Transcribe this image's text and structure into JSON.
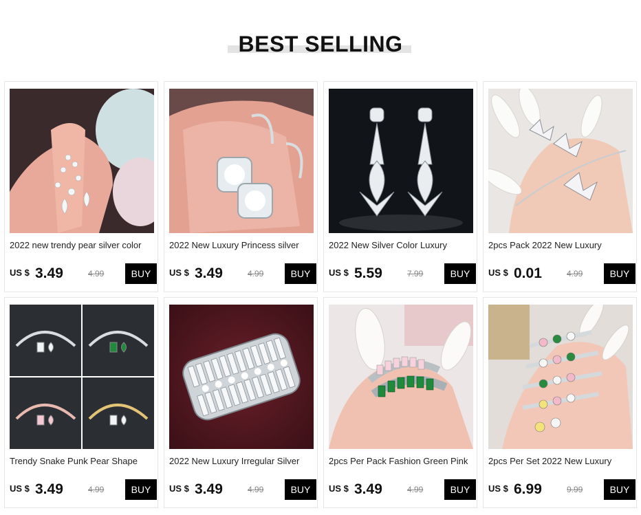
{
  "section": {
    "title": "BEST SELLING"
  },
  "products": [
    {
      "name": "2022 new trendy pear silver color",
      "currency": "US $",
      "price": "3.49",
      "old_price": "4.99",
      "buy_label": "BUY",
      "image": "hand-holding-drop-earring-photo"
    },
    {
      "name": "2022 New Luxury Princess silver",
      "currency": "US $",
      "price": "3.49",
      "old_price": "4.99",
      "buy_label": "BUY",
      "image": "hoop-square-earrings-photo"
    },
    {
      "name": "2022 New Silver Color Luxury",
      "currency": "US $",
      "price": "5.59",
      "old_price": "7.99",
      "buy_label": "BUY",
      "image": "teardrop-chandelier-earrings-photo"
    },
    {
      "name": "2pcs Pack 2022 New Luxury",
      "currency": "US $",
      "price": "0.01",
      "old_price": "4.99",
      "buy_label": "BUY",
      "image": "butterfly-jewelry-set-photo"
    },
    {
      "name": "Trendy Snake Punk Pear Shape",
      "currency": "US $",
      "price": "3.49",
      "old_price": "4.99",
      "buy_label": "BUY",
      "image": "open-cuff-bracelets-photo"
    },
    {
      "name": "2022 New Luxury Irregular Silver",
      "currency": "US $",
      "price": "3.49",
      "old_price": "4.99",
      "buy_label": "BUY",
      "image": "wide-baguette-ring-photo"
    },
    {
      "name": "2pcs Per Pack Fashion Green Pink",
      "currency": "US $",
      "price": "3.49",
      "old_price": "4.99",
      "buy_label": "BUY",
      "image": "green-pink-stacking-rings-photo"
    },
    {
      "name": "2pcs Per Set 2022 New Luxury",
      "currency": "US $",
      "price": "6.99",
      "old_price": "9.99",
      "buy_label": "BUY",
      "image": "colorful-ring-stack-photo"
    }
  ]
}
